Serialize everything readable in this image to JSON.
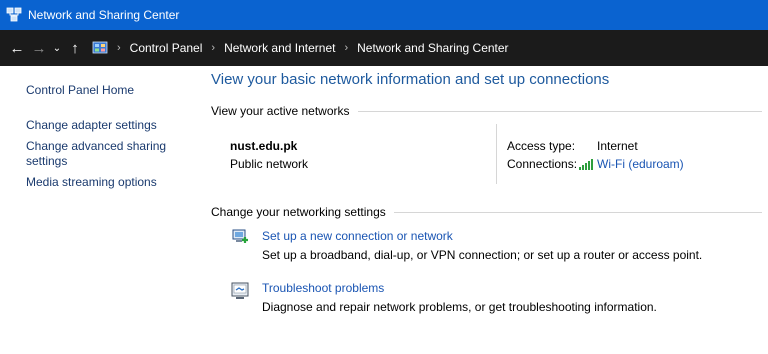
{
  "window": {
    "title": "Network and Sharing Center",
    "app_icon": "network-center-icon"
  },
  "navigation": {
    "back_glyph": "←",
    "forward_glyph": "→",
    "recent_glyph": "⌄",
    "up_glyph": "↑",
    "separator": "›",
    "breadcrumbs": [
      "Control Panel",
      "Network and Internet",
      "Network and Sharing Center"
    ]
  },
  "sidebar": {
    "home_label": "Control Panel Home",
    "links": [
      "Change adapter settings",
      "Change advanced sharing settings",
      "Media streaming options"
    ]
  },
  "main": {
    "title": "View your basic network information and set up connections",
    "active_networks": {
      "header": "View your active networks",
      "network_name": "nust.edu.pk",
      "network_type": "Public network",
      "access_type_label": "Access type:",
      "access_type_value": "Internet",
      "connections_label": "Connections:",
      "connection_value": "Wi-Fi (eduroam)"
    },
    "change_settings": {
      "header": "Change your networking settings",
      "tasks": [
        {
          "icon": "new-connection-icon",
          "link": "Set up a new connection or network",
          "description": "Set up a broadband, dial-up, or VPN connection; or set up a router or access point."
        },
        {
          "icon": "troubleshoot-icon",
          "link": "Troubleshoot problems",
          "description": "Diagnose and repair network problems, or get troubleshooting information."
        }
      ]
    }
  },
  "colors": {
    "titlebar": "#0a63d0",
    "addressbar": "#1b1b1b",
    "link": "#1a55b3",
    "heading": "#1e5a9e"
  }
}
